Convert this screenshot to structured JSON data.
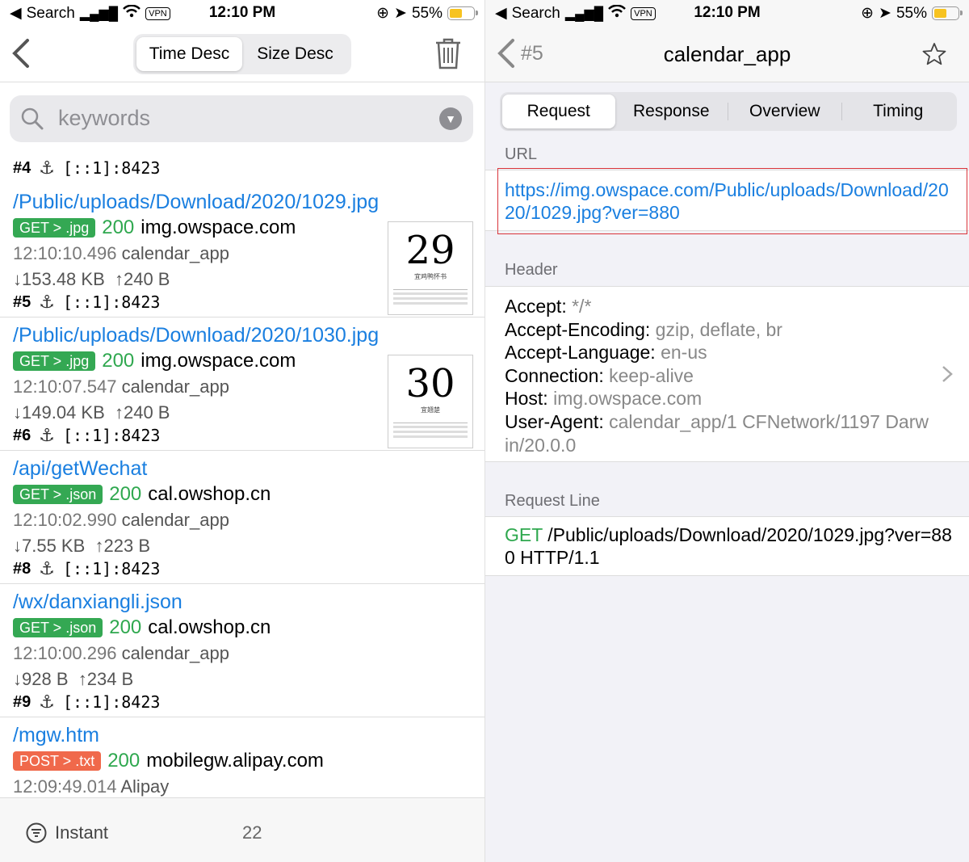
{
  "status_left": {
    "back_app": "Search",
    "time": "12:10 PM",
    "battery": "55%",
    "vpn": "VPN"
  },
  "status_right": {
    "back_app": "Search",
    "time": "12:10 PM",
    "battery": "55%",
    "vpn": "VPN"
  },
  "list_screen": {
    "sort_tabs": [
      "Time Desc",
      "Size Desc"
    ],
    "active_sort": "Time Desc",
    "search_placeholder": "keywords",
    "entries": [
      {
        "id": "#4",
        "addr": "[::1]:8423"
      },
      {
        "path": "/Public/uploads/Download/2020/1029.jpg",
        "badge": "GET > .jpg",
        "method_color": "#34a853",
        "status": "200",
        "host": "img.owspace.com",
        "time": "12:10:10.496",
        "app": "calendar_app",
        "down": "↓153.48 KB",
        "up": "↑240 B",
        "id": "#5",
        "addr": "[::1]:8423",
        "thumb_number": "29",
        "thumb_caption": "宜鸡鸭怀书"
      },
      {
        "path": "/Public/uploads/Download/2020/1030.jpg",
        "badge": "GET > .jpg",
        "method_color": "#34a853",
        "status": "200",
        "host": "img.owspace.com",
        "time": "12:10:07.547",
        "app": "calendar_app",
        "down": "↓149.04 KB",
        "up": "↑240 B",
        "id": "#6",
        "addr": "[::1]:8423",
        "thumb_number": "30",
        "thumb_caption": "宜翘楚"
      },
      {
        "path": "/api/getWechat",
        "badge": "GET > .json",
        "method_color": "#34a853",
        "status": "200",
        "host": "cal.owshop.cn",
        "time": "12:10:02.990",
        "app": "calendar_app",
        "down": "↓7.55 KB",
        "up": "↑223 B",
        "id": "#8",
        "addr": "[::1]:8423"
      },
      {
        "path": "/wx/danxiangli.json",
        "badge": "GET > .json",
        "method_color": "#34a853",
        "status": "200",
        "host": "cal.owshop.cn",
        "time": "12:10:00.296",
        "app": "calendar_app",
        "down": "↓928 B",
        "up": "↑234 B",
        "id": "#9",
        "addr": "[::1]:8423"
      },
      {
        "path": "/mgw.htm",
        "badge": "POST > .txt",
        "method_color": "#f0694b",
        "status": "200",
        "host": "mobilegw.alipay.com",
        "time": "12:09:49.014",
        "app": "Alipay"
      }
    ],
    "bottom": {
      "filter_label": "Instant",
      "count": "22"
    }
  },
  "detail_screen": {
    "back_number": "#5",
    "title": "calendar_app",
    "tabs": [
      "Request",
      "Response",
      "Overview",
      "Timing"
    ],
    "active_tab": "Request",
    "url_header": "URL",
    "url": "https://img.owspace.com/Public/uploads/Download/2020/1029.jpg?ver=880",
    "header_title": "Header",
    "headers": [
      {
        "k": "Accept:",
        "v": "*/*"
      },
      {
        "k": "Accept-Encoding:",
        "v": "gzip, deflate, br"
      },
      {
        "k": "Accept-Language:",
        "v": "en-us"
      },
      {
        "k": "Connection:",
        "v": "keep-alive"
      },
      {
        "k": "Host:",
        "v": "img.owspace.com"
      },
      {
        "k": "User-Agent:",
        "v": "calendar_app/1 CFNetwork/1197 Darwin/20.0.0"
      }
    ],
    "request_line_title": "Request Line",
    "request_line_method": "GET",
    "request_line_rest": "/Public/uploads/Download/2020/1029.jpg?ver=880 HTTP/1.1"
  }
}
